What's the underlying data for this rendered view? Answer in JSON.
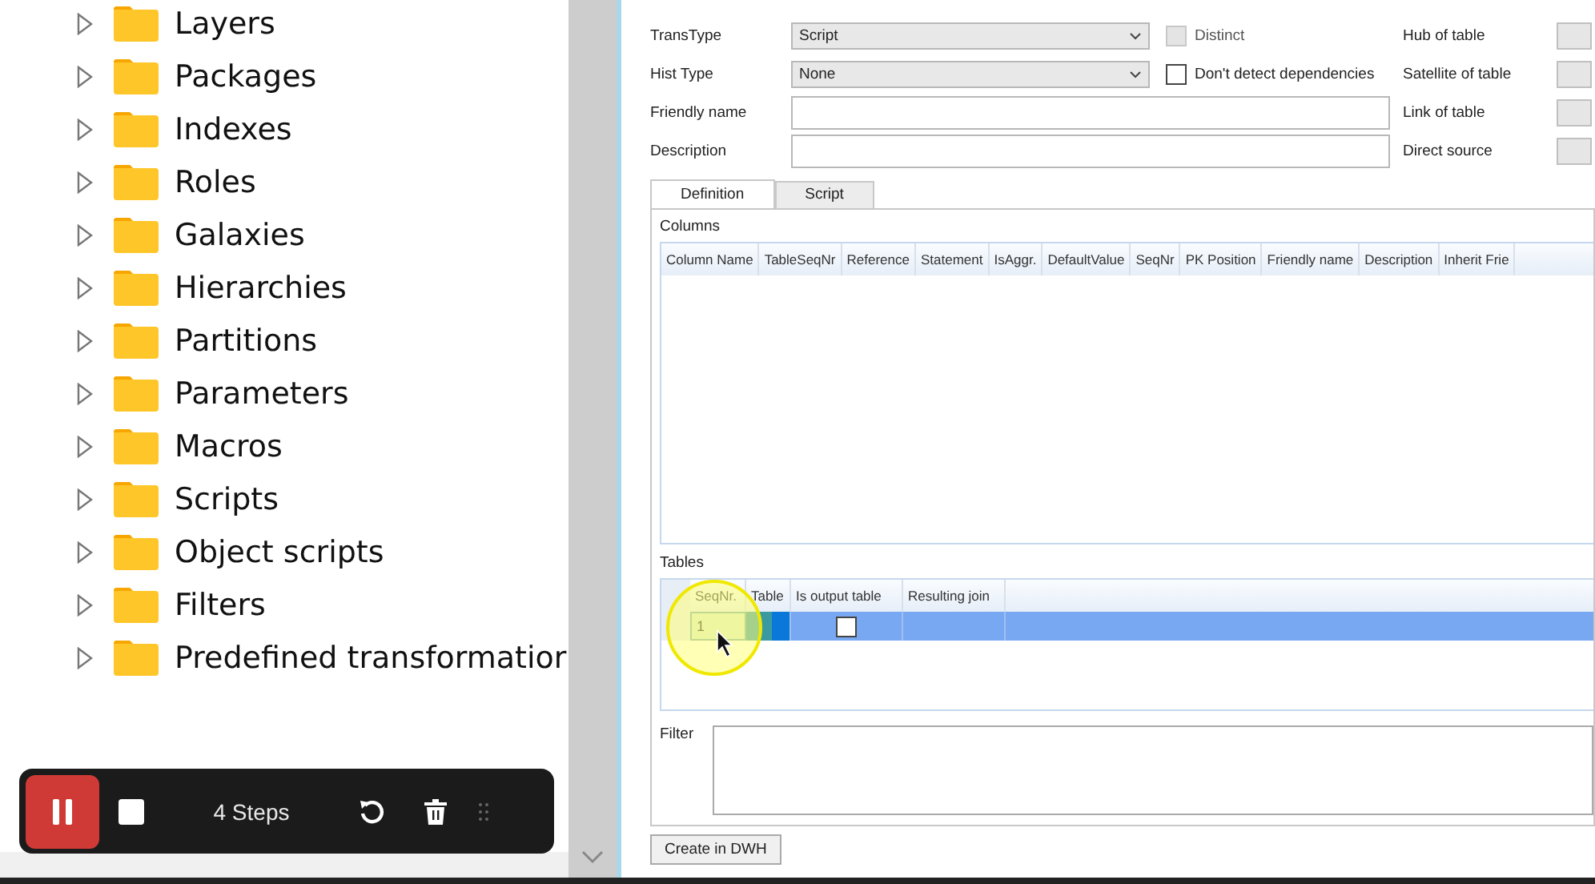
{
  "tree": {
    "items": [
      {
        "label": "Layers",
        "expanded": false
      },
      {
        "label": "Packages",
        "expanded": false
      },
      {
        "label": "Indexes",
        "expanded": false
      },
      {
        "label": "Roles",
        "expanded": false
      },
      {
        "label": "Galaxies",
        "expanded": false
      },
      {
        "label": "Hierarchies",
        "expanded": false
      },
      {
        "label": "Partitions",
        "expanded": false
      },
      {
        "label": "Parameters",
        "expanded": false
      },
      {
        "label": "Macros",
        "expanded": false
      },
      {
        "label": "Scripts",
        "expanded": false
      },
      {
        "label": "Object scripts",
        "expanded": false
      },
      {
        "label": "Filters",
        "expanded": false
      },
      {
        "label": "Predefined transformatior",
        "expanded": false
      }
    ]
  },
  "recorder": {
    "steps": "4 Steps"
  },
  "form": {
    "rows": [
      {
        "label": "TransType",
        "kind": "select",
        "value": "Script",
        "check": {
          "label": "Distinct",
          "checked": false,
          "disabled": true
        },
        "right_label": "Hub of table"
      },
      {
        "label": "Hist Type",
        "kind": "select",
        "value": "None",
        "check": {
          "label": "Don't detect dependencies",
          "checked": false,
          "disabled": false
        },
        "right_label": "Satellite of table"
      },
      {
        "label": "Friendly name",
        "kind": "text",
        "right_label": "Link of table"
      },
      {
        "label": "Description",
        "kind": "text",
        "right_label": "Direct source"
      }
    ]
  },
  "tabs": [
    {
      "label": "Definition",
      "selected": true
    },
    {
      "label": "Script",
      "selected": false
    }
  ],
  "columns_grid": {
    "title": "Columns",
    "columns": [
      "Column Name",
      "TableSeqNr",
      "Reference",
      "Statement",
      "IsAggr.",
      "DefaultValue",
      "SeqNr",
      "PK Position",
      "Friendly name",
      "Description",
      "Inherit Frie"
    ]
  },
  "tables_grid": {
    "title": "Tables",
    "columns": [
      "SeqNr.",
      "Table",
      "Is output table",
      "Resulting join"
    ],
    "rows": [
      {
        "selected": true,
        "seq": "1",
        "is_output": false
      }
    ]
  },
  "filter": {
    "label": "Filter"
  },
  "create_button": "Create in DWH"
}
